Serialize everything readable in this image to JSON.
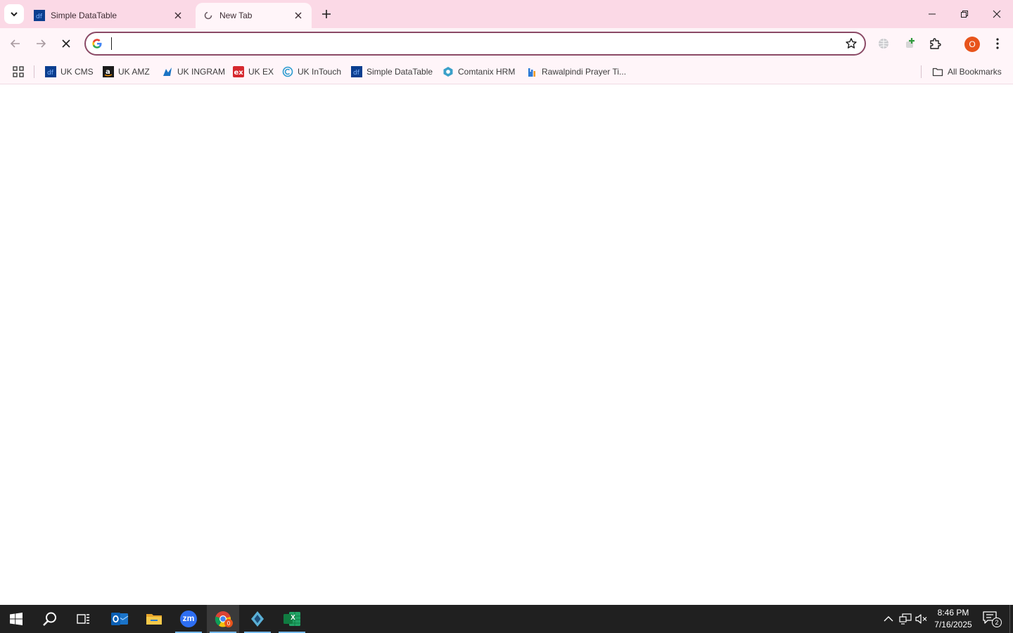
{
  "browser": {
    "tabs": [
      {
        "title": "Simple DataTable",
        "favicon": "df-icon",
        "active": false
      },
      {
        "title": "New Tab",
        "favicon": "loading-icon",
        "active": true
      }
    ],
    "omnibox": {
      "value": "",
      "placeholder": ""
    },
    "profile_initial": "O",
    "colors": {
      "tabstrip": "#fbd9e6",
      "toolbar": "#fff5f9",
      "omnibox_border": "#8b4a66",
      "avatar": "#e8541c"
    }
  },
  "bookmarks": {
    "items": [
      {
        "label": "UK CMS",
        "icon": "df-icon"
      },
      {
        "label": "UK AMZ",
        "icon": "amazon-icon"
      },
      {
        "label": "UK INGRAM",
        "icon": "ingram-icon"
      },
      {
        "label": "UK EX",
        "icon": "ex-icon"
      },
      {
        "label": "UK InTouch",
        "icon": "intouch-icon"
      },
      {
        "label": "Simple DataTable",
        "icon": "df-icon"
      },
      {
        "label": "Comtanix HRM",
        "icon": "comtanix-icon"
      },
      {
        "label": "Rawalpindi Prayer Ti...",
        "icon": "prayer-icon"
      }
    ],
    "all_bookmarks": "All Bookmarks"
  },
  "taskbar": {
    "apps": [
      "start-icon",
      "search-icon",
      "task-view-icon",
      "outlook-icon",
      "file-explorer-icon",
      "zoom-icon",
      "chrome-icon",
      "app-icon",
      "excel-icon"
    ],
    "zoom_label": "zm",
    "chrome_badge": "0",
    "excel_label": "X",
    "time": "8:46 PM",
    "date": "7/16/2025",
    "notifications": "2"
  }
}
